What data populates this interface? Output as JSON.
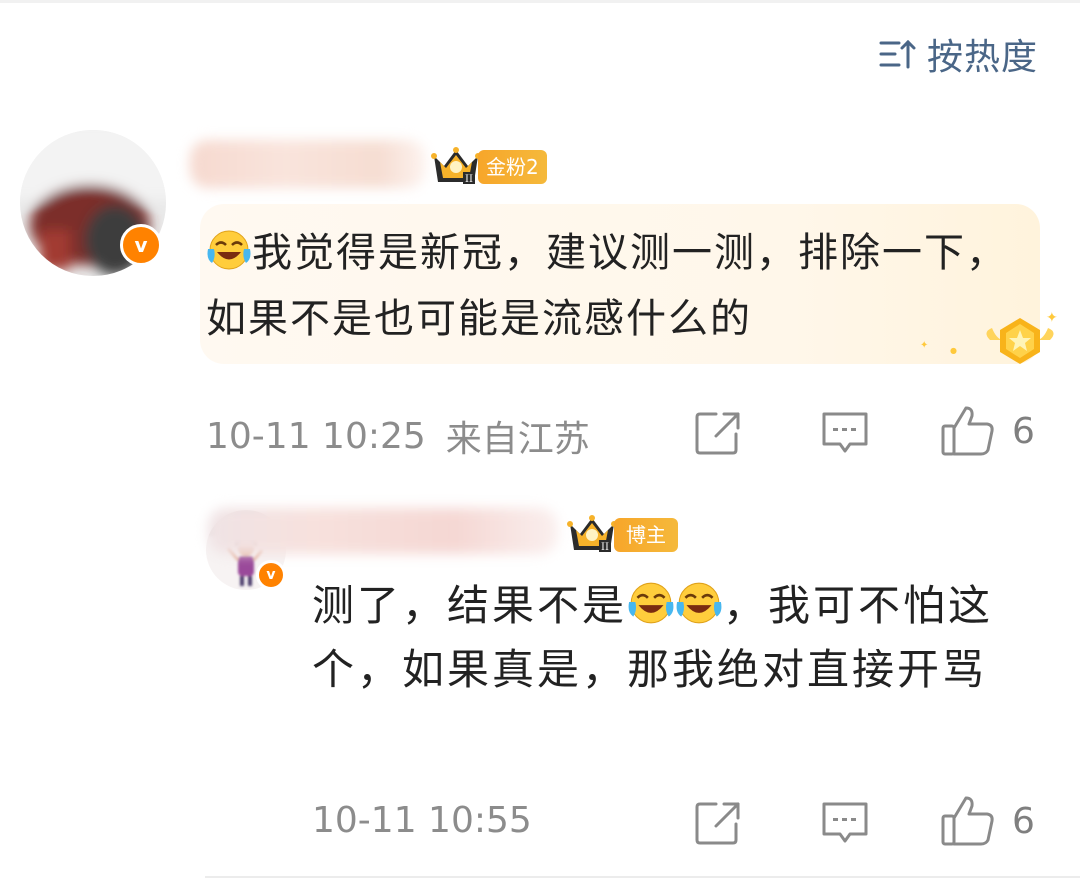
{
  "sort": {
    "label": "按热度",
    "icon": "sort-icon"
  },
  "comments": [
    {
      "badge": {
        "label": "金粉2",
        "icon": "crown-icon"
      },
      "text_before_emoji": "",
      "text": "我觉得是新冠，建议测一测，排除一下，如果不是也可能是流感什么的",
      "emoji": "laugh-cry-emoji",
      "time": "10-11 10:25",
      "location": "来自江苏",
      "likes": "6",
      "verified_badge": "v"
    },
    {
      "badge": {
        "label": "博主",
        "icon": "crown-icon"
      },
      "text_part1": "测了，结果不是",
      "emoji": "laugh-cry-emoji",
      "text_part2": "，我可不怕这个，如果真是，那我绝对直接开骂",
      "time": "10-11 10:55",
      "likes": "6",
      "verified_badge": "v"
    }
  ],
  "colors": {
    "link_blue": "#4a6687",
    "badge_orange": "#f7a62a",
    "verified_orange": "#ff8200",
    "meta_gray": "#8c8c8c"
  }
}
